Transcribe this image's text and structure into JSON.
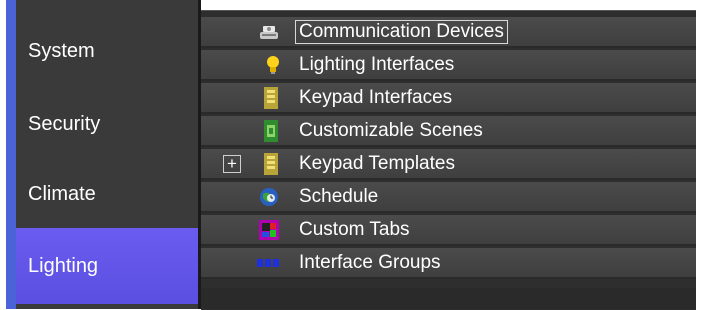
{
  "sidebar": {
    "items": [
      {
        "label": "System"
      },
      {
        "label": "Security"
      },
      {
        "label": "Climate"
      },
      {
        "label": "Lighting"
      }
    ],
    "active_index": 3
  },
  "tree": {
    "items": [
      {
        "label": "Communication Devices",
        "icon": "communication-devices-icon",
        "selected": true
      },
      {
        "label": "Lighting Interfaces",
        "icon": "lightbulb-icon"
      },
      {
        "label": "Keypad Interfaces",
        "icon": "keypad-icon"
      },
      {
        "label": "Customizable Scenes",
        "icon": "scene-icon"
      },
      {
        "label": "Keypad Templates",
        "icon": "keypad-icon",
        "expander": "+"
      },
      {
        "label": "Schedule",
        "icon": "globe-clock-icon"
      },
      {
        "label": "Custom Tabs",
        "icon": "custom-tabs-icon"
      },
      {
        "label": "Interface Groups",
        "icon": "interface-groups-icon"
      }
    ]
  },
  "colors": {
    "sidebar_bg": "#3a3a3a",
    "sidebar_active": "#5a4fe0",
    "sidebar_strip": "#4a64d8",
    "row_bg": "#454545"
  }
}
